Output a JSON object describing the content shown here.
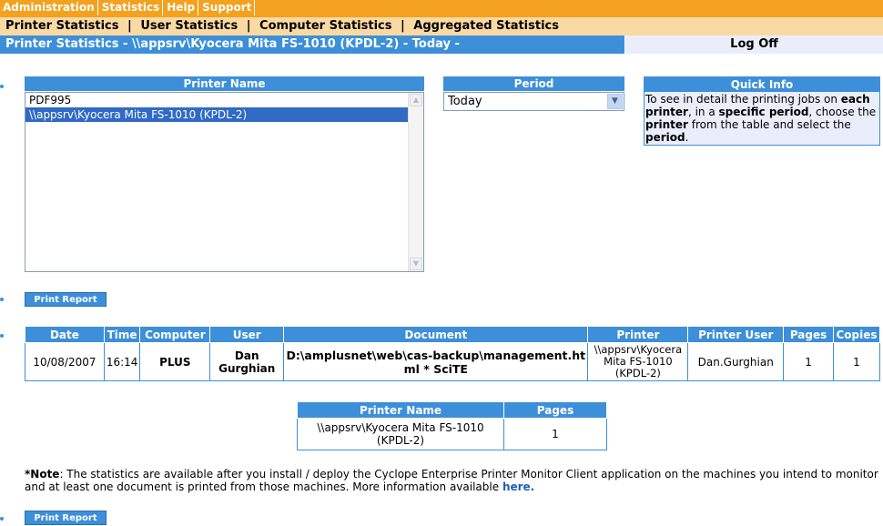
{
  "menu": [
    "Administration",
    "Statistics",
    "Help",
    "Support"
  ],
  "subnav": [
    "Printer Statistics",
    "User Statistics",
    "Computer Statistics",
    "Aggregated Statistics"
  ],
  "subnav_sep": "|",
  "title": "Printer Statistics - \\\\appsrv\\Kyocera Mita FS-1010 (KPDL-2) - Today -",
  "logoff": "Log Off",
  "printer_panel": {
    "header": "Printer Name",
    "items": [
      "PDF995",
      "\\\\appsrv\\Kyocera Mita FS-1010 (KPDL-2)"
    ],
    "selected_index": 1
  },
  "period": {
    "header": "Period",
    "value": "Today"
  },
  "quick_info": {
    "header": "Quick Info",
    "t1": "To see in detail the printing jobs on ",
    "b1": "each printer",
    "t2": ", in a ",
    "b2": "specific period",
    "t3": ", choose the ",
    "b3": "printer",
    "t4": " from the table and select the ",
    "b4": "period",
    "t5": "."
  },
  "print_report": "Print Report",
  "jobs_table": {
    "headers": [
      "Date",
      "Time",
      "Computer",
      "User",
      "Document",
      "Printer",
      "Printer User",
      "Pages",
      "Copies"
    ],
    "row": {
      "date": "10/08/2007",
      "time": "16:14",
      "computer": "PLUS",
      "user": "Dan Gurghian",
      "document": "D:\\amplusnet\\web\\cas-backup\\management.html * SciTE",
      "printer": "\\\\appsrv\\Kyocera Mita FS-1010 (KPDL-2)",
      "printer_user": "Dan.Gurghian",
      "pages": "1",
      "copies": "1"
    }
  },
  "summary_table": {
    "headers": [
      "Printer Name",
      "Pages"
    ],
    "row": {
      "printer": "\\\\appsrv\\Kyocera Mita FS-1010 (KPDL-2)",
      "pages": "1"
    }
  },
  "note": {
    "label": "*Note",
    "text": ": The statistics are available after you install / deploy the Cyclope Enterprise Printer Monitor Client application on the machines you intend to monitor and at least one document is printed from those machines. More information available ",
    "link": "here."
  },
  "colors": {
    "accent": "#3d8fd9",
    "menu": "#f3a11e",
    "subnav": "#fbd9a3",
    "selected": "#316ac5"
  }
}
